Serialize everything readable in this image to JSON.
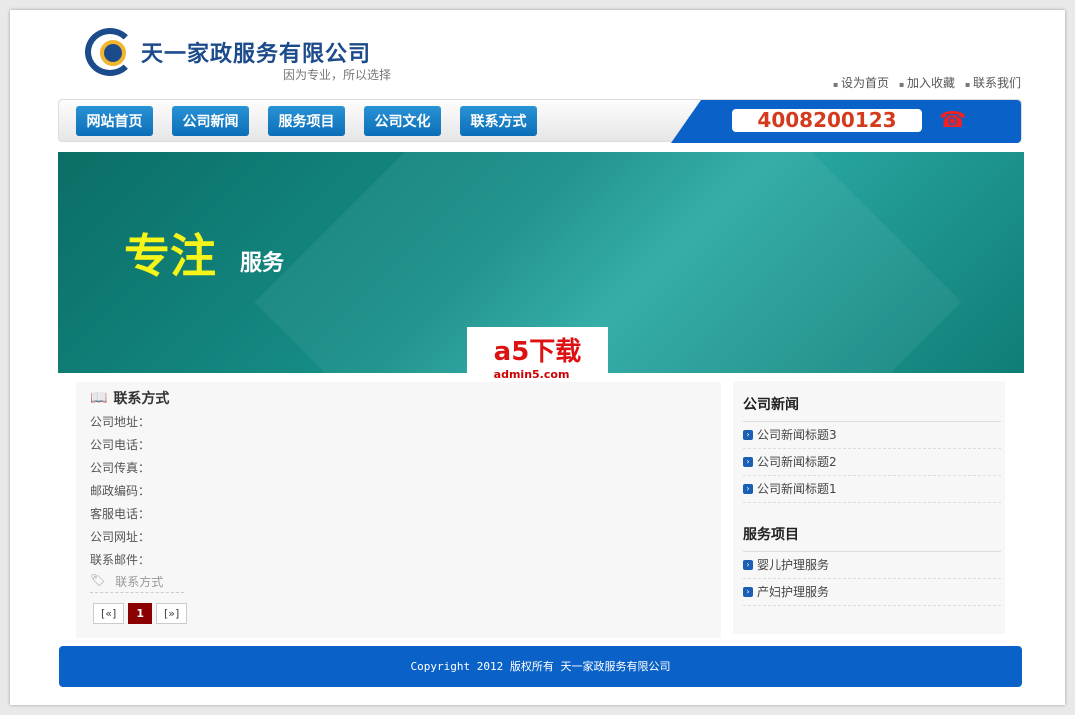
{
  "header": {
    "company": "天一家政服务有限公司",
    "slogan": "因为专业，所以选择",
    "links": [
      "设为首页",
      "加入收藏",
      "联系我们"
    ],
    "phone": "4008200123"
  },
  "nav": [
    "网站首页",
    "公司新闻",
    "服务项目",
    "公司文化",
    "联系方式"
  ],
  "banner": {
    "big": "专注",
    "small": "服务"
  },
  "watermark": {
    "logo": "a5下载",
    "url": "admin5.com"
  },
  "contact": {
    "title": "联系方式",
    "fields": [
      "公司地址：",
      "公司电话：",
      "公司传真：",
      "邮政编码：",
      "客服电话：",
      "公司网址：",
      "联系邮件："
    ],
    "tag": "联系方式",
    "pager": {
      "prev": "[«]",
      "current": "1",
      "next": "[»]"
    }
  },
  "sidebar": {
    "news_title": "公司新闻",
    "news": [
      "公司新闻标题3",
      "公司新闻标题2",
      "公司新闻标题1"
    ],
    "services_title": "服务项目",
    "services": [
      "婴儿护理服务",
      "产妇护理服务"
    ]
  },
  "footer": "Copyright 2012 版权所有 天一家政服务有限公司"
}
